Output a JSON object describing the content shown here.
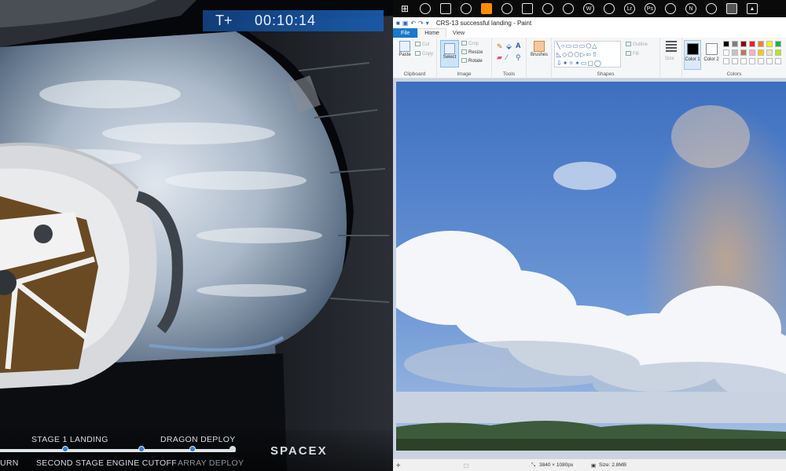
{
  "video": {
    "timer_prefix": "T+",
    "timer_value": "00:10:14",
    "logo_text": "SPACEX",
    "timeline": {
      "progress_percent": 98,
      "upper_labels": [
        "STAGE 1 LANDING",
        "DRAGON DEPLOY"
      ],
      "lower_labels": [
        "URN",
        "SECOND STAGE ENGINE CUTOFF",
        "ARRAY DEPLOY"
      ]
    }
  },
  "taskbar": {
    "icons": [
      "windows-icon",
      "cortana-icon",
      "task-view-icon",
      "steam-icon",
      "vlc-icon",
      "game-icon",
      "app-icon",
      "bluetooth-icon",
      "chrome-icon",
      "word-icon",
      "clock-icon",
      "lightroom-icon",
      "photoshop-icon",
      "tool-icon",
      "onenote-icon",
      "mail-icon",
      "paint-icon",
      "photos-icon"
    ]
  },
  "paint": {
    "title": "CRS-13 successful landing - Paint",
    "menu": {
      "file": "File",
      "home": "Home",
      "view": "View"
    },
    "ribbon": {
      "clipboard": {
        "label": "Clipboard",
        "paste": "Paste",
        "cut": "Cut",
        "copy": "Copy"
      },
      "image": {
        "label": "Image",
        "select": "Select",
        "crop": "Crop",
        "resize": "Resize",
        "rotate": "Rotate"
      },
      "tools": {
        "label": "Tools"
      },
      "brushes": {
        "label": "Brushes"
      },
      "shapes": {
        "label": "Shapes",
        "outline": "Outline",
        "fill": "Fill"
      },
      "size": {
        "label": "Size"
      },
      "colors": {
        "label": "Colors",
        "color1_label": "Color 1",
        "color2_label": "Color 2",
        "color1": "#000000",
        "color2": "#ffffff",
        "palette_row1": [
          "#000000",
          "#7f7f7f",
          "#880015",
          "#ed1c24",
          "#ff7f27",
          "#fff200",
          "#22b14c"
        ],
        "palette_row2": [
          "#ffffff",
          "#c3c3c3",
          "#b97a57",
          "#ffaec9",
          "#ffc90e",
          "#efe4b0",
          "#b5e61d"
        ],
        "palette_row3": [
          "#ffffff",
          "#ffffff",
          "#ffffff",
          "#ffffff",
          "#ffffff",
          "#ffffff",
          "#ffffff"
        ]
      }
    },
    "status": {
      "dimensions": "3840 × 1080px",
      "size": "Size: 2.8MB"
    }
  }
}
